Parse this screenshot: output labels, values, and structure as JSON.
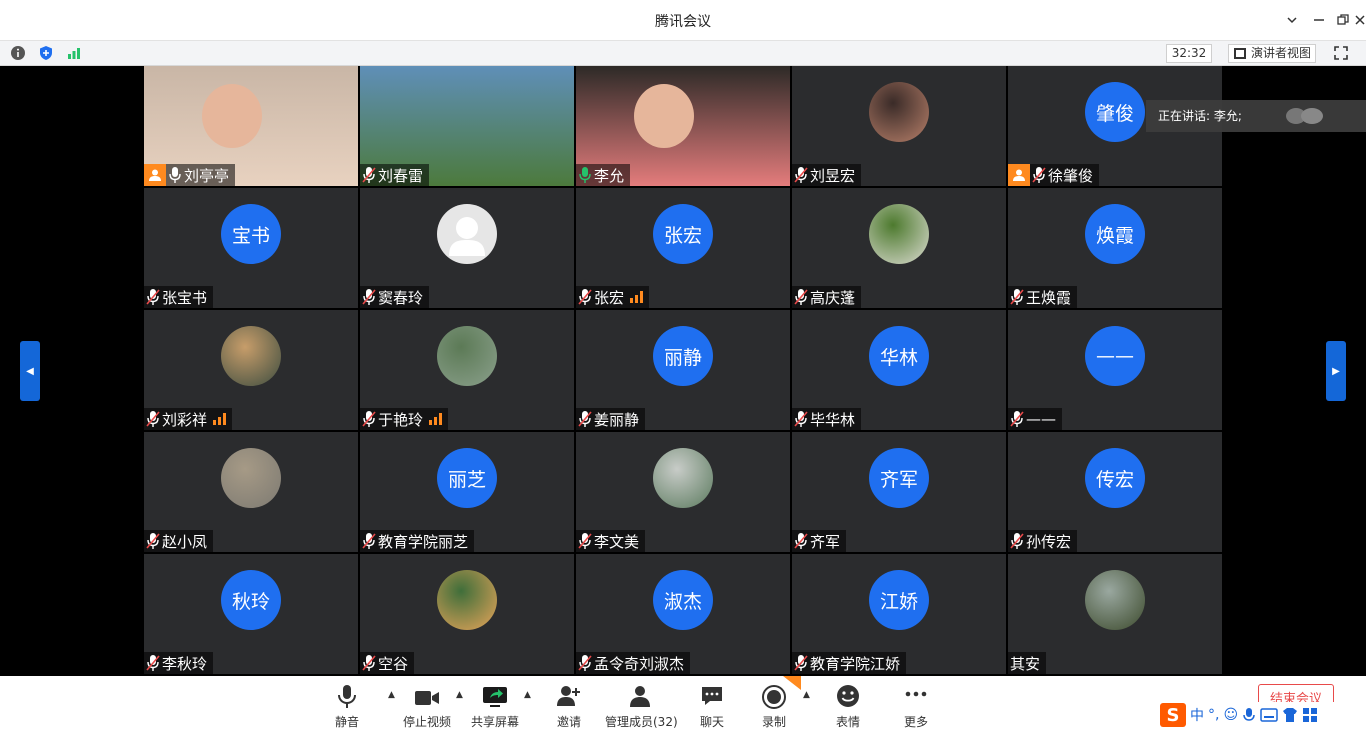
{
  "window": {
    "title": "腾讯会议"
  },
  "infobar": {
    "timer": "32:32",
    "presenter_view": "演讲者视图"
  },
  "speaking": {
    "label": "正在讲话: 李允;"
  },
  "colors": {
    "avatar_blue": "#1f6ff0",
    "host_orange": "#ff8a1f",
    "speaking_green": "#25c26b",
    "end_red": "#e84a4a"
  },
  "participants": [
    {
      "name": "刘亭亭",
      "initials": "",
      "avatar": "photo-woman",
      "host": true,
      "mic": "on"
    },
    {
      "name": "刘春雷",
      "initials": "",
      "avatar": "photo-landscape",
      "host": false,
      "mic": "muted"
    },
    {
      "name": "李允",
      "initials": "",
      "avatar": "photo-woman-smiling",
      "host": false,
      "mic": "speaking"
    },
    {
      "name": "刘昱宏",
      "initials": "",
      "avatar": "photo-guitar",
      "host": false,
      "mic": "muted"
    },
    {
      "name": "徐肇俊",
      "initials": "肇俊",
      "avatar": "initials",
      "host": true,
      "mic": "muted"
    },
    {
      "name": "张宝书",
      "initials": "宝书",
      "avatar": "initials",
      "host": false,
      "mic": "muted"
    },
    {
      "name": "窦春玲",
      "initials": "",
      "avatar": "default-person",
      "host": false,
      "mic": "muted"
    },
    {
      "name": "张宏",
      "initials": "张宏",
      "avatar": "initials",
      "host": false,
      "mic": "muted",
      "signal": true
    },
    {
      "name": "高庆蓬",
      "initials": "",
      "avatar": "photo-plant",
      "host": false,
      "mic": "muted"
    },
    {
      "name": "王焕霞",
      "initials": "焕霞",
      "avatar": "initials",
      "host": false,
      "mic": "muted"
    },
    {
      "name": "刘彩祥",
      "initials": "",
      "avatar": "photo-sunset",
      "host": false,
      "mic": "muted",
      "signal": true
    },
    {
      "name": "于艳玲",
      "initials": "",
      "avatar": "photo-garden",
      "host": false,
      "mic": "muted",
      "signal": true
    },
    {
      "name": "姜丽静",
      "initials": "丽静",
      "avatar": "initials",
      "host": false,
      "mic": "muted"
    },
    {
      "name": "毕华林",
      "initials": "华林",
      "avatar": "initials",
      "host": false,
      "mic": "muted"
    },
    {
      "name": "——",
      "initials": "——",
      "avatar": "initials",
      "host": false,
      "mic": "muted"
    },
    {
      "name": "赵小凤",
      "initials": "",
      "avatar": "photo-family",
      "host": false,
      "mic": "muted"
    },
    {
      "name": "教育学院丽芝",
      "initials": "丽芝",
      "avatar": "initials",
      "host": false,
      "mic": "muted"
    },
    {
      "name": "李文美",
      "initials": "",
      "avatar": "photo-road",
      "host": false,
      "mic": "muted"
    },
    {
      "name": "齐军",
      "initials": "齐军",
      "avatar": "initials",
      "host": false,
      "mic": "muted"
    },
    {
      "name": "孙传宏",
      "initials": "传宏",
      "avatar": "initials",
      "host": false,
      "mic": "muted"
    },
    {
      "name": "李秋玲",
      "initials": "秋玲",
      "avatar": "initials",
      "host": false,
      "mic": "muted"
    },
    {
      "name": "空谷",
      "initials": "",
      "avatar": "photo-windmill",
      "host": false,
      "mic": "muted"
    },
    {
      "name": "孟令奇刘淑杰",
      "initials": "淑杰",
      "avatar": "initials",
      "host": false,
      "mic": "muted"
    },
    {
      "name": "教育学院江娇",
      "initials": "江娇",
      "avatar": "initials",
      "host": false,
      "mic": "muted"
    },
    {
      "name": "其安",
      "initials": "",
      "avatar": "photo-waterfall",
      "host": false,
      "mic": "none"
    }
  ],
  "toolbar": {
    "mute": "静音",
    "stop_video": "停止视频",
    "share_screen": "共享屏幕",
    "invite": "邀请",
    "manage_members": "管理成员(32)",
    "chat": "聊天",
    "record": "录制",
    "reactions": "表情",
    "more": "更多",
    "end_meeting": "结束会议"
  },
  "ime": {
    "lang": "中",
    "punct": "°,"
  }
}
